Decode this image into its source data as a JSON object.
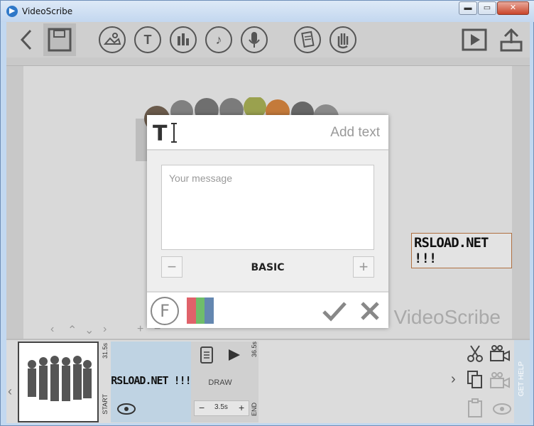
{
  "window": {
    "title": "VideoScribe",
    "minimize": "▬",
    "maximize": "▭",
    "close": "✕"
  },
  "canvas": {
    "text_element": "RSLOAD.NET !!!",
    "brand": "VideoScribe"
  },
  "dialog": {
    "title": "Add text",
    "message_placeholder": "Your message",
    "message_value": "",
    "style_label": "BASIC",
    "decrease_label": "−",
    "increase_label": "+",
    "font_label": "F",
    "colors": [
      "#e0626a",
      "#6fbd6a",
      "#6487b0"
    ]
  },
  "timeline": {
    "clip_title": "RSLOAD.NET !!!",
    "start_label": "START",
    "start_time": "31.5s",
    "end_label": "END",
    "end_time": "36.5s",
    "draw_label": "DRAW",
    "duration": "3.5s",
    "dur_minus": "−",
    "dur_plus": "+",
    "help_label": "GET HELP",
    "left_arrow": "‹",
    "right_arrow": "›"
  }
}
